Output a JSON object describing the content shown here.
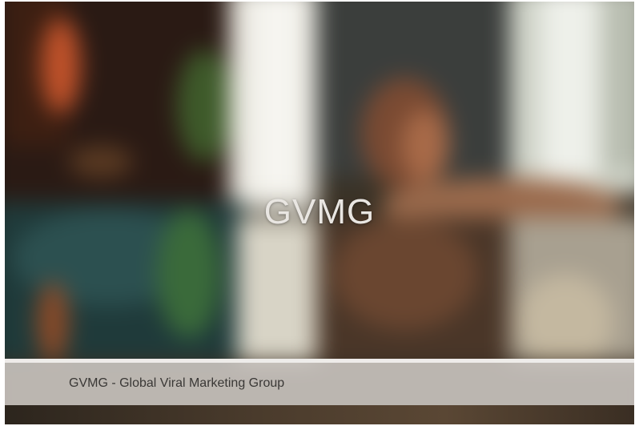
{
  "slide": {
    "title": "GVMG",
    "caption": "GVMG - Global Viral Marketing Group"
  },
  "colors": {
    "title_text": "#e9e6e2",
    "caption_bar": "#cdc8c4",
    "caption_text": "#3a3836"
  }
}
